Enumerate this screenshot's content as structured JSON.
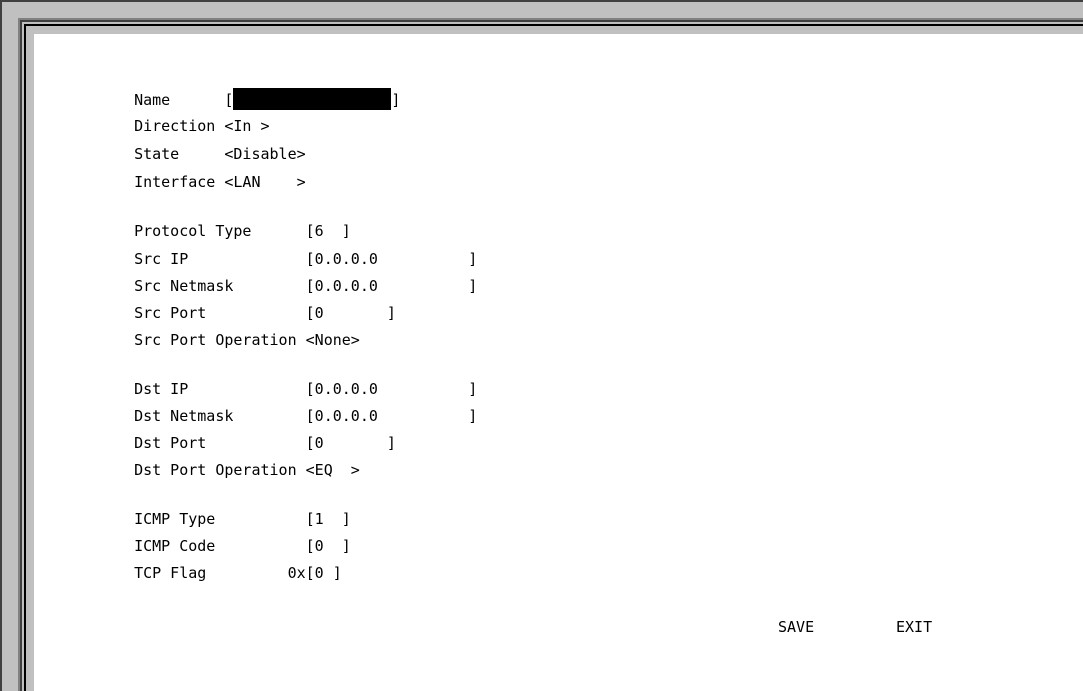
{
  "form": {
    "name": {
      "label": "Name",
      "value": ""
    },
    "direction": {
      "label": "Direction",
      "value": "<In >"
    },
    "state": {
      "label": "State",
      "value": "<Disable>"
    },
    "interface": {
      "label": "Interface",
      "value": "<LAN    >"
    },
    "protocol_type": {
      "label": "Protocol Type",
      "value": "[6  ]"
    },
    "src_ip": {
      "label": "Src IP",
      "value": "[0.0.0.0          ]"
    },
    "src_netmask": {
      "label": "Src Netmask",
      "value": "[0.0.0.0          ]"
    },
    "src_port": {
      "label": "Src Port",
      "value": "[0       ]"
    },
    "src_port_operation": {
      "label": "Src Port Operation",
      "value": "<None>"
    },
    "dst_ip": {
      "label": "Dst IP",
      "value": "[0.0.0.0          ]"
    },
    "dst_netmask": {
      "label": "Dst Netmask",
      "value": "[0.0.0.0          ]"
    },
    "dst_port": {
      "label": "Dst Port",
      "value": "[0       ]"
    },
    "dst_port_operation": {
      "label": "Dst Port Operation",
      "value": "<EQ  >"
    },
    "icmp_type": {
      "label": "ICMP Type",
      "value": "[1  ]"
    },
    "icmp_code": {
      "label": "ICMP Code",
      "value": "[0  ]"
    },
    "tcp_flag": {
      "label": "TCP Flag",
      "prefix": "0x",
      "value": "[0 ]"
    }
  },
  "actions": {
    "save_label": "SAVE",
    "exit_label": "EXIT"
  }
}
